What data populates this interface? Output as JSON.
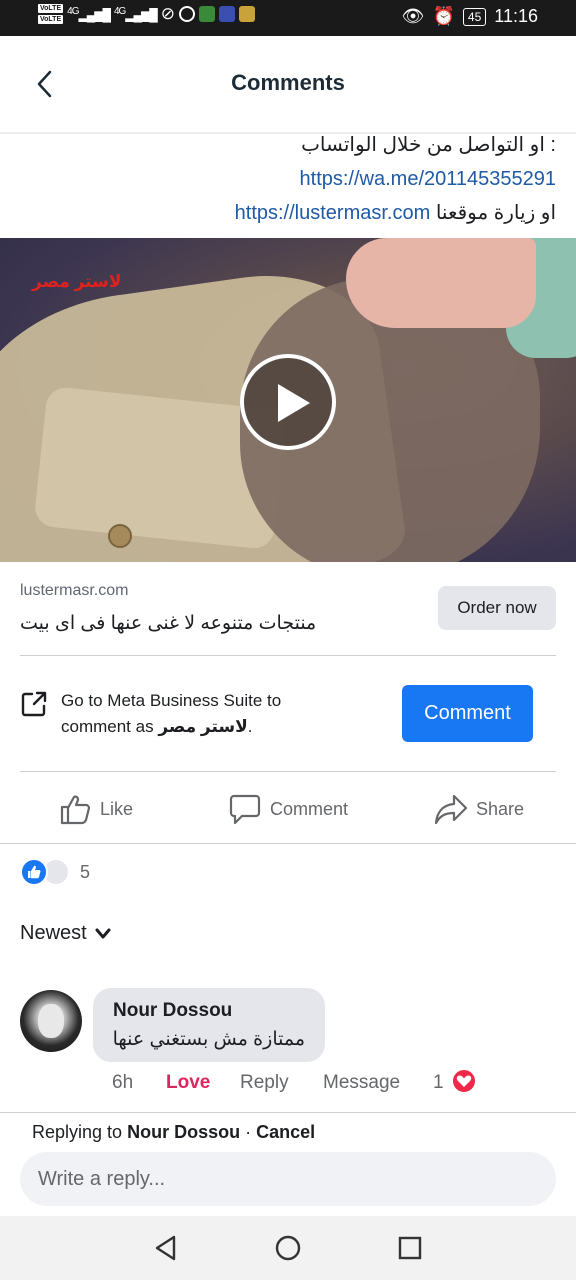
{
  "status_bar": {
    "volte1": "VoLTE",
    "volte2": "VoLTE",
    "signal1": "4G",
    "signal2": "4G",
    "battery": "45",
    "time": "11:16"
  },
  "header": {
    "title": "Comments"
  },
  "post": {
    "line1": "او التواصل من خلال الواتساب :",
    "whatsapp_link": "https://wa.me/201145355291",
    "line3_prefix": "او زيارة موقعنا",
    "site_link": "https://lustermasr.com"
  },
  "video": {
    "watermark": "لاستر مصر"
  },
  "link_card": {
    "domain": "lustermasr.com",
    "description": "منتجات متنوعه لا غنى عنها فى اى بيت",
    "button": "Order now"
  },
  "meta_business": {
    "text_line1": "Go to Meta Business Suite to",
    "text_line2_prefix": "comment as",
    "page_name": "لاستر مصر",
    "text_line2_suffix": ".",
    "button": "Comment"
  },
  "actions": {
    "like": "Like",
    "comment": "Comment",
    "share": "Share"
  },
  "reactions": {
    "count": "5"
  },
  "sort": {
    "label": "Newest"
  },
  "comment": {
    "author": "Nour Dossou",
    "body": "ممتازة مش بستغني عنها",
    "time": "6h",
    "reaction_label": "Love",
    "reply": "Reply",
    "message": "Message",
    "reaction_count": "1"
  },
  "reply_box": {
    "replying_prefix": "Replying to",
    "replying_name": "Nour Dossou",
    "separator": " · ",
    "cancel": "Cancel",
    "placeholder": "Write a reply..."
  },
  "colors": {
    "accent": "#1877f2",
    "love": "#e0245e",
    "link": "#1f5aa6",
    "watermark": "#e0221f"
  }
}
